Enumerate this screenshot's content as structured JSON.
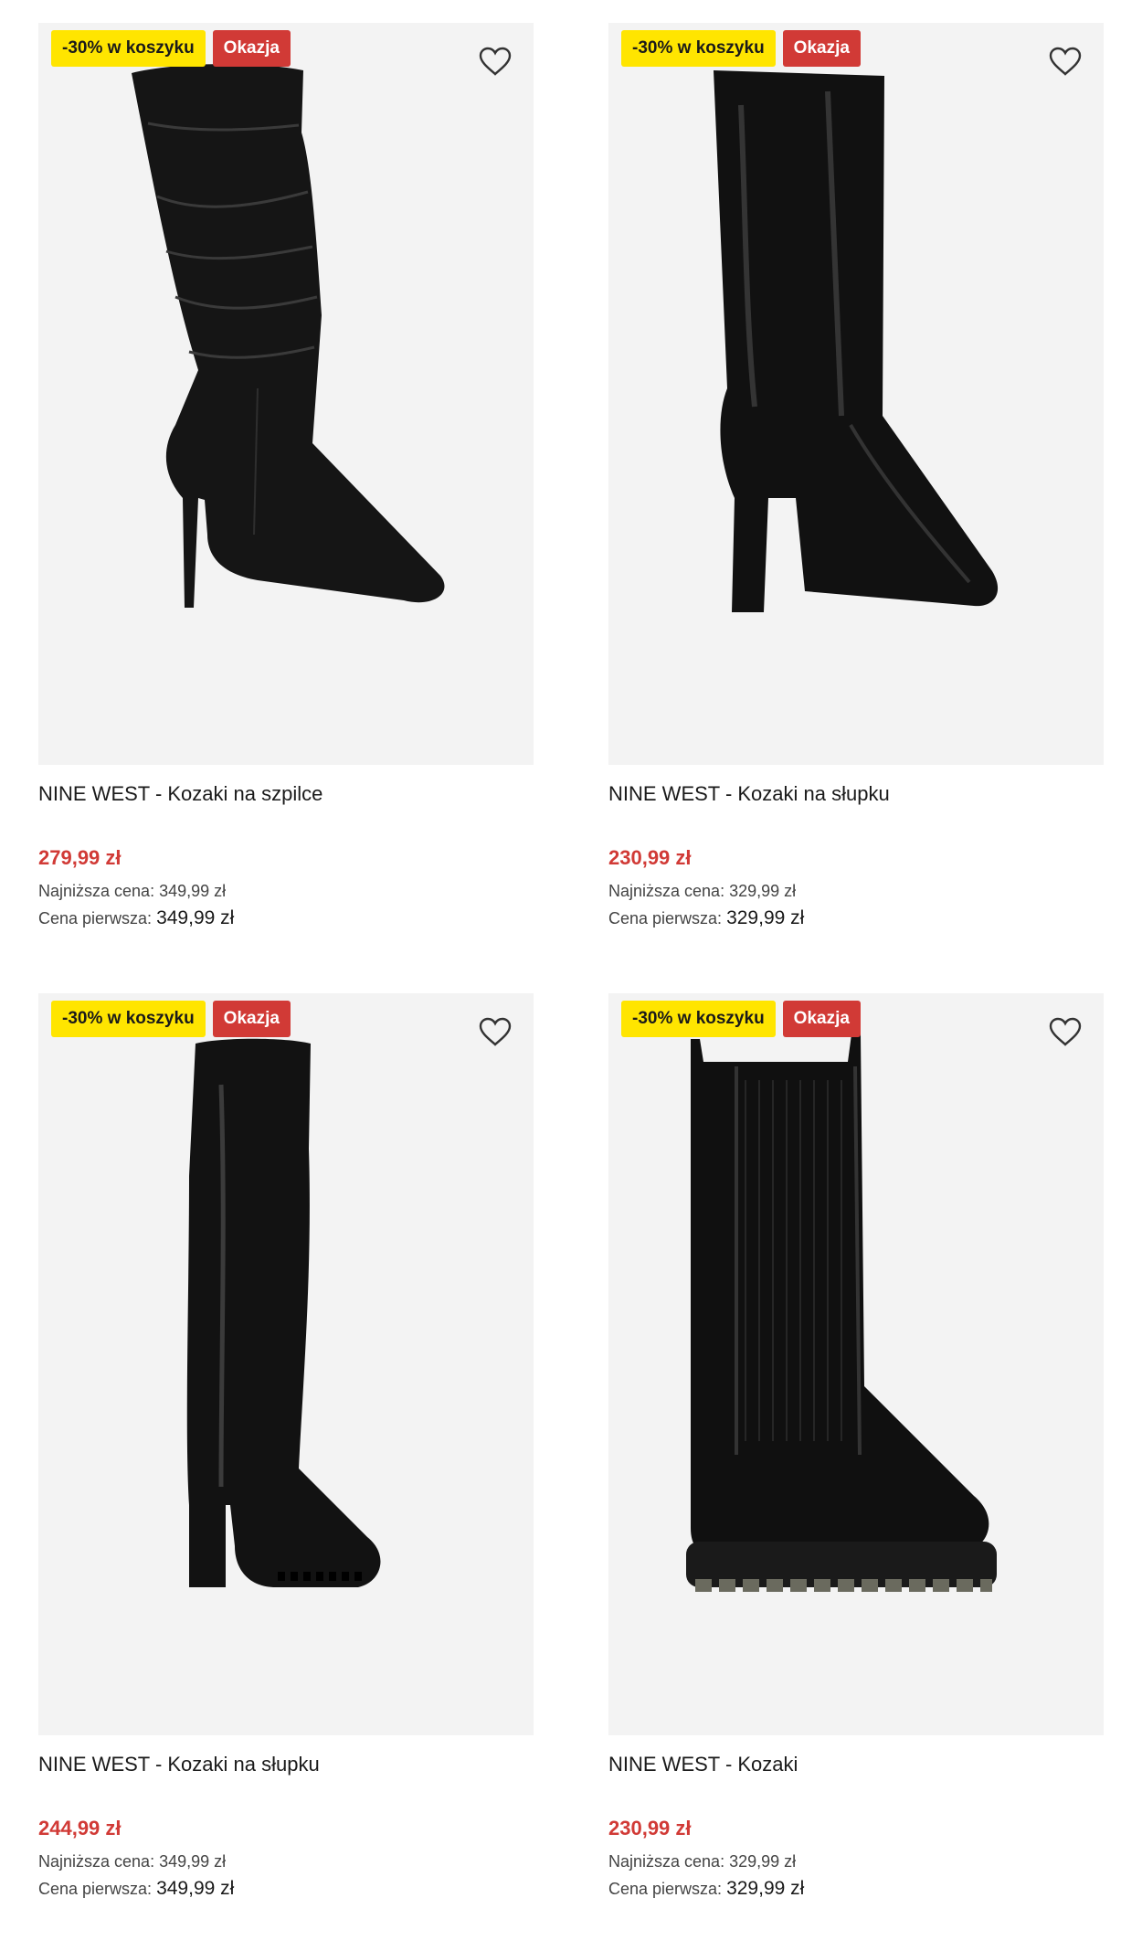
{
  "products": [
    {
      "badge_discount": "-30% w koszyku",
      "badge_deal": "Okazja",
      "title": "NINE WEST - Kozaki na szpilce",
      "price": "279,99 zł",
      "lowest_label": "Najniższa cena:",
      "lowest_value": "349,99 zł",
      "first_label": "Cena pierwsza:",
      "first_value": "349,99 zł"
    },
    {
      "badge_discount": "-30% w koszyku",
      "badge_deal": "Okazja",
      "title": "NINE WEST - Kozaki na słupku",
      "price": "230,99 zł",
      "lowest_label": "Najniższa cena:",
      "lowest_value": "329,99 zł",
      "first_label": "Cena pierwsza:",
      "first_value": "329,99 zł"
    },
    {
      "badge_discount": "-30% w koszyku",
      "badge_deal": "Okazja",
      "title": "NINE WEST - Kozaki na słupku",
      "price": "244,99 zł",
      "lowest_label": "Najniższa cena:",
      "lowest_value": "349,99 zł",
      "first_label": "Cena pierwsza:",
      "first_value": "349,99 zł"
    },
    {
      "badge_discount": "-30% w koszyku",
      "badge_deal": "Okazja",
      "title": "NINE WEST - Kozaki",
      "price": "230,99 zł",
      "lowest_label": "Najniższa cena:",
      "lowest_value": "329,99 zł",
      "first_label": "Cena pierwsza:",
      "first_value": "329,99 zł"
    }
  ],
  "icons": {
    "favorite": "heart-outline-icon"
  },
  "colors": {
    "promo_badge": "#ffe500",
    "deal_badge": "#d13a36",
    "sale_price": "#d13a36",
    "image_bg": "#f3f3f3"
  }
}
